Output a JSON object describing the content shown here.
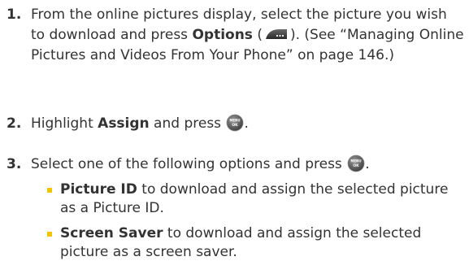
{
  "steps": [
    {
      "number": "1.",
      "text_a": "From the online pictures display, select the picture you wish to download and press ",
      "bold": "Options",
      "text_b": " (",
      "text_c": "). (See “Managing Online Pictures and Videos From Your Phone” on page 146.)",
      "key_icon": "options-softkey-icon"
    },
    {
      "number": "2.",
      "text_a": "Highlight ",
      "bold": "Assign",
      "text_b": " and press ",
      "text_c": ".",
      "key_icon": "menu-ok-key-icon"
    },
    {
      "number": "3.",
      "text_a": "Select one of the following options and press ",
      "text_c": ".",
      "key_icon": "menu-ok-key-icon"
    }
  ],
  "options": [
    {
      "bold": "Picture ID",
      "text": " to download and assign the selected picture as a Picture ID."
    },
    {
      "bold": "Screen Saver",
      "text": " to download and assign the selected picture as a screen saver."
    }
  ],
  "colors": {
    "text": "#333333",
    "bullet": "#f0c400"
  }
}
